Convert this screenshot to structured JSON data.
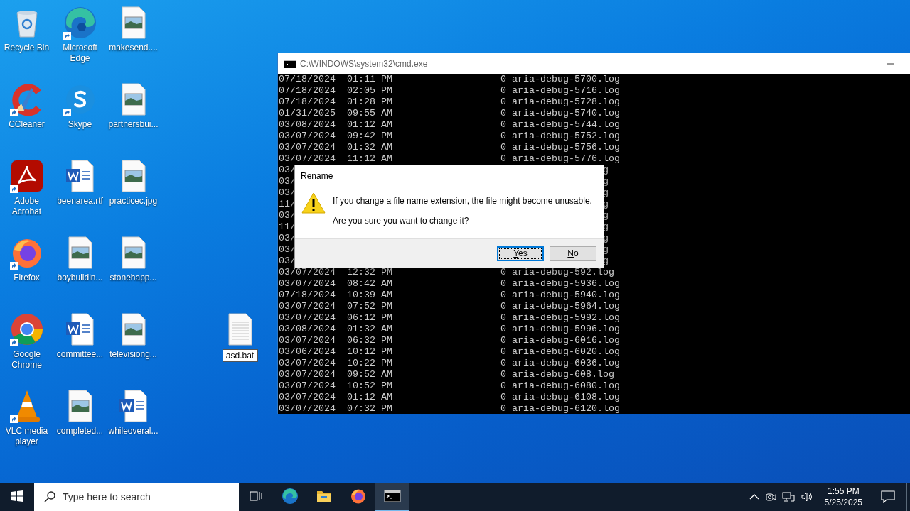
{
  "desktop": {
    "icons": [
      {
        "label": "Recycle Bin",
        "kind": "recycle",
        "shortcut": false
      },
      {
        "label": "CCleaner",
        "kind": "ccleaner",
        "shortcut": true
      },
      {
        "label": "Adobe Acrobat",
        "kind": "acrobat",
        "shortcut": true
      },
      {
        "label": "Firefox",
        "kind": "firefox",
        "shortcut": true
      },
      {
        "label": "Google Chrome",
        "kind": "chrome",
        "shortcut": true
      },
      {
        "label": "VLC media player",
        "kind": "vlc",
        "shortcut": true
      },
      {
        "label": "Microsoft Edge",
        "kind": "edge",
        "shortcut": true
      },
      {
        "label": "Skype",
        "kind": "skype",
        "shortcut": true
      },
      {
        "label": "beenarea.rtf",
        "kind": "word",
        "shortcut": false
      },
      {
        "label": "boybuildin...",
        "kind": "image",
        "shortcut": false
      },
      {
        "label": "committee...",
        "kind": "word",
        "shortcut": false
      },
      {
        "label": "completed...",
        "kind": "image",
        "shortcut": false
      },
      {
        "label": "makesend....",
        "kind": "image",
        "shortcut": false
      },
      {
        "label": "partnersbui...",
        "kind": "image",
        "shortcut": false
      },
      {
        "label": "practicec.jpg",
        "kind": "image",
        "shortcut": false
      },
      {
        "label": "stonehapp...",
        "kind": "image",
        "shortcut": false
      },
      {
        "label": "televisiong...",
        "kind": "image",
        "shortcut": false
      },
      {
        "label": "whileoveral...",
        "kind": "word",
        "shortcut": false
      }
    ],
    "renaming": {
      "value": "asd.bat",
      "kind": "text"
    }
  },
  "console_window": {
    "title": "C:\\WINDOWS\\system32\\cmd.exe",
    "lines": [
      {
        "kind": "full",
        "text": "07/18/2024  01:11 PM                   0 aria-debug-5700.log"
      },
      {
        "kind": "full",
        "text": "07/18/2024  02:05 PM                   0 aria-debug-5716.log"
      },
      {
        "kind": "full",
        "text": "07/18/2024  01:28 PM                   0 aria-debug-5728.log"
      },
      {
        "kind": "full",
        "text": "01/31/2025  09:55 AM                   0 aria-debug-5740.log"
      },
      {
        "kind": "full",
        "text": "03/08/2024  01:12 AM                   0 aria-debug-5744.log"
      },
      {
        "kind": "full",
        "text": "03/07/2024  09:42 PM                   0 aria-debug-5752.log"
      },
      {
        "kind": "full",
        "text": "03/07/2024  01:32 AM                   0 aria-debug-5756.log"
      },
      {
        "kind": "full",
        "text": "03/07/2024  11:12 AM                   0 aria-debug-5776.log"
      },
      {
        "kind": "partial",
        "left": "03/",
        "right": "g"
      },
      {
        "kind": "partial",
        "left": "03/",
        "right": "g"
      },
      {
        "kind": "partial",
        "left": "03/",
        "right": "g"
      },
      {
        "kind": "partial",
        "left": "11/",
        "right": "g"
      },
      {
        "kind": "partial",
        "left": "03/",
        "right": "g"
      },
      {
        "kind": "partial",
        "left": "11/",
        "right": "g"
      },
      {
        "kind": "partial",
        "left": "03/",
        "right": "g"
      },
      {
        "kind": "partial",
        "left": "03/",
        "right": "g"
      },
      {
        "kind": "partial",
        "left": "03/",
        "right": "g"
      },
      {
        "kind": "full",
        "text": "03/07/2024  12:32 PM                   0 aria-debug-592.log"
      },
      {
        "kind": "full",
        "text": "03/07/2024  08:42 AM                   0 aria-debug-5936.log"
      },
      {
        "kind": "full",
        "text": "07/18/2024  10:39 AM                   0 aria-debug-5940.log"
      },
      {
        "kind": "full",
        "text": "03/07/2024  07:52 PM                   0 aria-debug-5964.log"
      },
      {
        "kind": "full",
        "text": "03/07/2024  06:12 PM                   0 aria-debug-5992.log"
      },
      {
        "kind": "full",
        "text": "03/08/2024  01:32 AM                   0 aria-debug-5996.log"
      },
      {
        "kind": "full",
        "text": "03/07/2024  06:32 PM                   0 aria-debug-6016.log"
      },
      {
        "kind": "full",
        "text": "03/06/2024  10:12 PM                   0 aria-debug-6020.log"
      },
      {
        "kind": "full",
        "text": "03/07/2024  10:22 PM                   0 aria-debug-6036.log"
      },
      {
        "kind": "full",
        "text": "03/07/2024  09:52 AM                   0 aria-debug-608.log"
      },
      {
        "kind": "full",
        "text": "03/07/2024  10:52 PM                   0 aria-debug-6080.log"
      },
      {
        "kind": "full",
        "text": "03/07/2024  01:12 AM                   0 aria-debug-6108.log"
      },
      {
        "kind": "full",
        "text": "03/07/2024  07:32 PM                   0 aria-debug-6120.log"
      }
    ]
  },
  "dialog": {
    "title": "Rename",
    "message": "If you change a file name extension, the file might become unusable.",
    "question": "Are you sure you want to change it?",
    "buttons": [
      {
        "label": "Yes",
        "focused": true
      },
      {
        "label": "No",
        "focused": false
      }
    ]
  },
  "taskbar": {
    "search": {
      "placeholder": "Type here to search"
    },
    "apps": [
      {
        "kind": "edge",
        "active": false
      },
      {
        "kind": "explorer",
        "active": false
      },
      {
        "kind": "firefox",
        "active": false
      },
      {
        "kind": "cmd",
        "active": true
      }
    ],
    "clock": {
      "time": "1:55 PM",
      "date": "5/25/2025"
    }
  }
}
